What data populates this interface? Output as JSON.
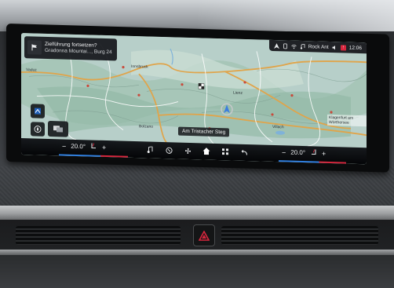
{
  "status_bar": {
    "media_label": "Rock Ant",
    "time": "12:06",
    "icons": [
      "navigation-arrow-icon",
      "phone-icon",
      "wifi-icon",
      "media-icon",
      "mute-icon",
      "notification-icon"
    ]
  },
  "guidance": {
    "prompt": "Zielführung fortsetzen?",
    "destination": "Gradonna Mountai..., Burg 24",
    "icon": "flag-icon"
  },
  "map": {
    "poi_label": "Am Tristacher Steg",
    "cities": [
      "Vaduz",
      "Innsbruck",
      "Lienz",
      "Villach",
      "Bolzano",
      "Klagenfurt am Wörthersee"
    ],
    "colors": {
      "land": "#b7cfc9",
      "forest": "#8fb7a3",
      "road_major": "#e0a44a",
      "road_minor": "#ffffff",
      "water": "#7fb2d9"
    }
  },
  "climate": {
    "left": {
      "minus": "−",
      "temp": "20.0°",
      "plus": "+"
    },
    "right": {
      "minus": "−",
      "temp": "20.0°",
      "plus": "+"
    },
    "colors": {
      "cool": "#2f7fe0",
      "warm": "#d7263d"
    }
  },
  "nav_bar": {
    "buttons": [
      "music-icon",
      "phone-icon",
      "fan-icon",
      "home-icon",
      "apps-icon",
      "back-icon"
    ]
  }
}
